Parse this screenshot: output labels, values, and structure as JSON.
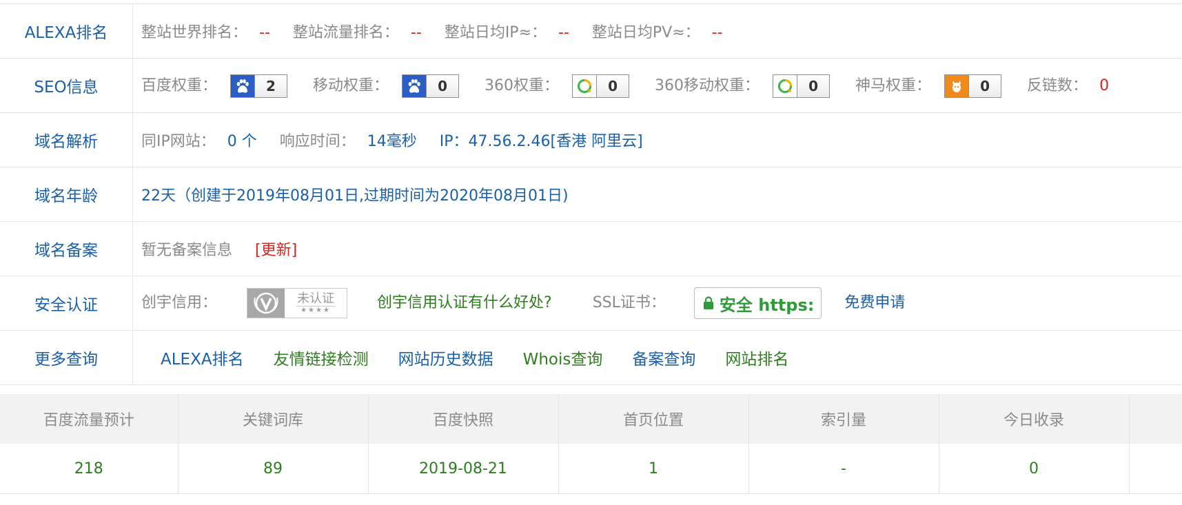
{
  "rows": {
    "alexa": {
      "label": "ALEXA排名",
      "world_rank_label": "整站世界排名：",
      "world_rank": "--",
      "flow_rank_label": "整站流量排名：",
      "flow_rank": "--",
      "daily_ip_label": "整站日均IP≈：",
      "daily_ip": "--",
      "daily_pv_label": "整站日均PV≈：",
      "daily_pv": "--"
    },
    "seo": {
      "label": "SEO信息",
      "baidu_label": "百度权重：",
      "baidu_value": "2",
      "mobile_label": "移动权重：",
      "mobile_value": "0",
      "s360_label": "360权重：",
      "s360_value": "0",
      "s360m_label": "360移动权重：",
      "s360m_value": "0",
      "shenma_label": "神马权重：",
      "shenma_value": "0",
      "backlinks_label": "反链数：",
      "backlinks_value": "0"
    },
    "dns": {
      "label": "域名解析",
      "same_ip_label": "同IP网站：",
      "same_ip_value": "0 个",
      "response_label": "响应时间：",
      "response_value": "14毫秒",
      "ip_text": "IP：47.56.2.46[香港 阿里云]"
    },
    "age": {
      "label": "域名年龄",
      "value": "22天（创建于2019年08月01日,过期时间为2020年08月01日)"
    },
    "icp": {
      "label": "域名备案",
      "value": "暂无备案信息",
      "update_link": "[更新]"
    },
    "security": {
      "label": "安全认证",
      "cy_label": "创宇信用：",
      "cy_badge_text": "未认证",
      "cy_badge_stars": "★★★★",
      "cy_link": "创宇信用认证有什么好处?",
      "ssl_label": "SSL证书：",
      "ssl_badge_text": "安全 https:",
      "ssl_link": "免费申请"
    },
    "more": {
      "label": "更多查询",
      "links": [
        "ALEXA排名",
        "友情链接检测",
        "网站历史数据",
        "Whois查询",
        "备案查询",
        "网站排名"
      ]
    }
  },
  "stats": {
    "headers": [
      "百度流量预计",
      "关键词库",
      "百度快照",
      "首页位置",
      "索引量",
      "今日收录"
    ],
    "values": [
      "218",
      "89",
      "2019-08-21",
      "1",
      "-",
      "0"
    ]
  },
  "colors": {
    "label_blue": "#1a5fa8",
    "value_red": "#d9251d",
    "link_green": "#2e7d1f",
    "ssl_green": "#2e9a3a"
  }
}
